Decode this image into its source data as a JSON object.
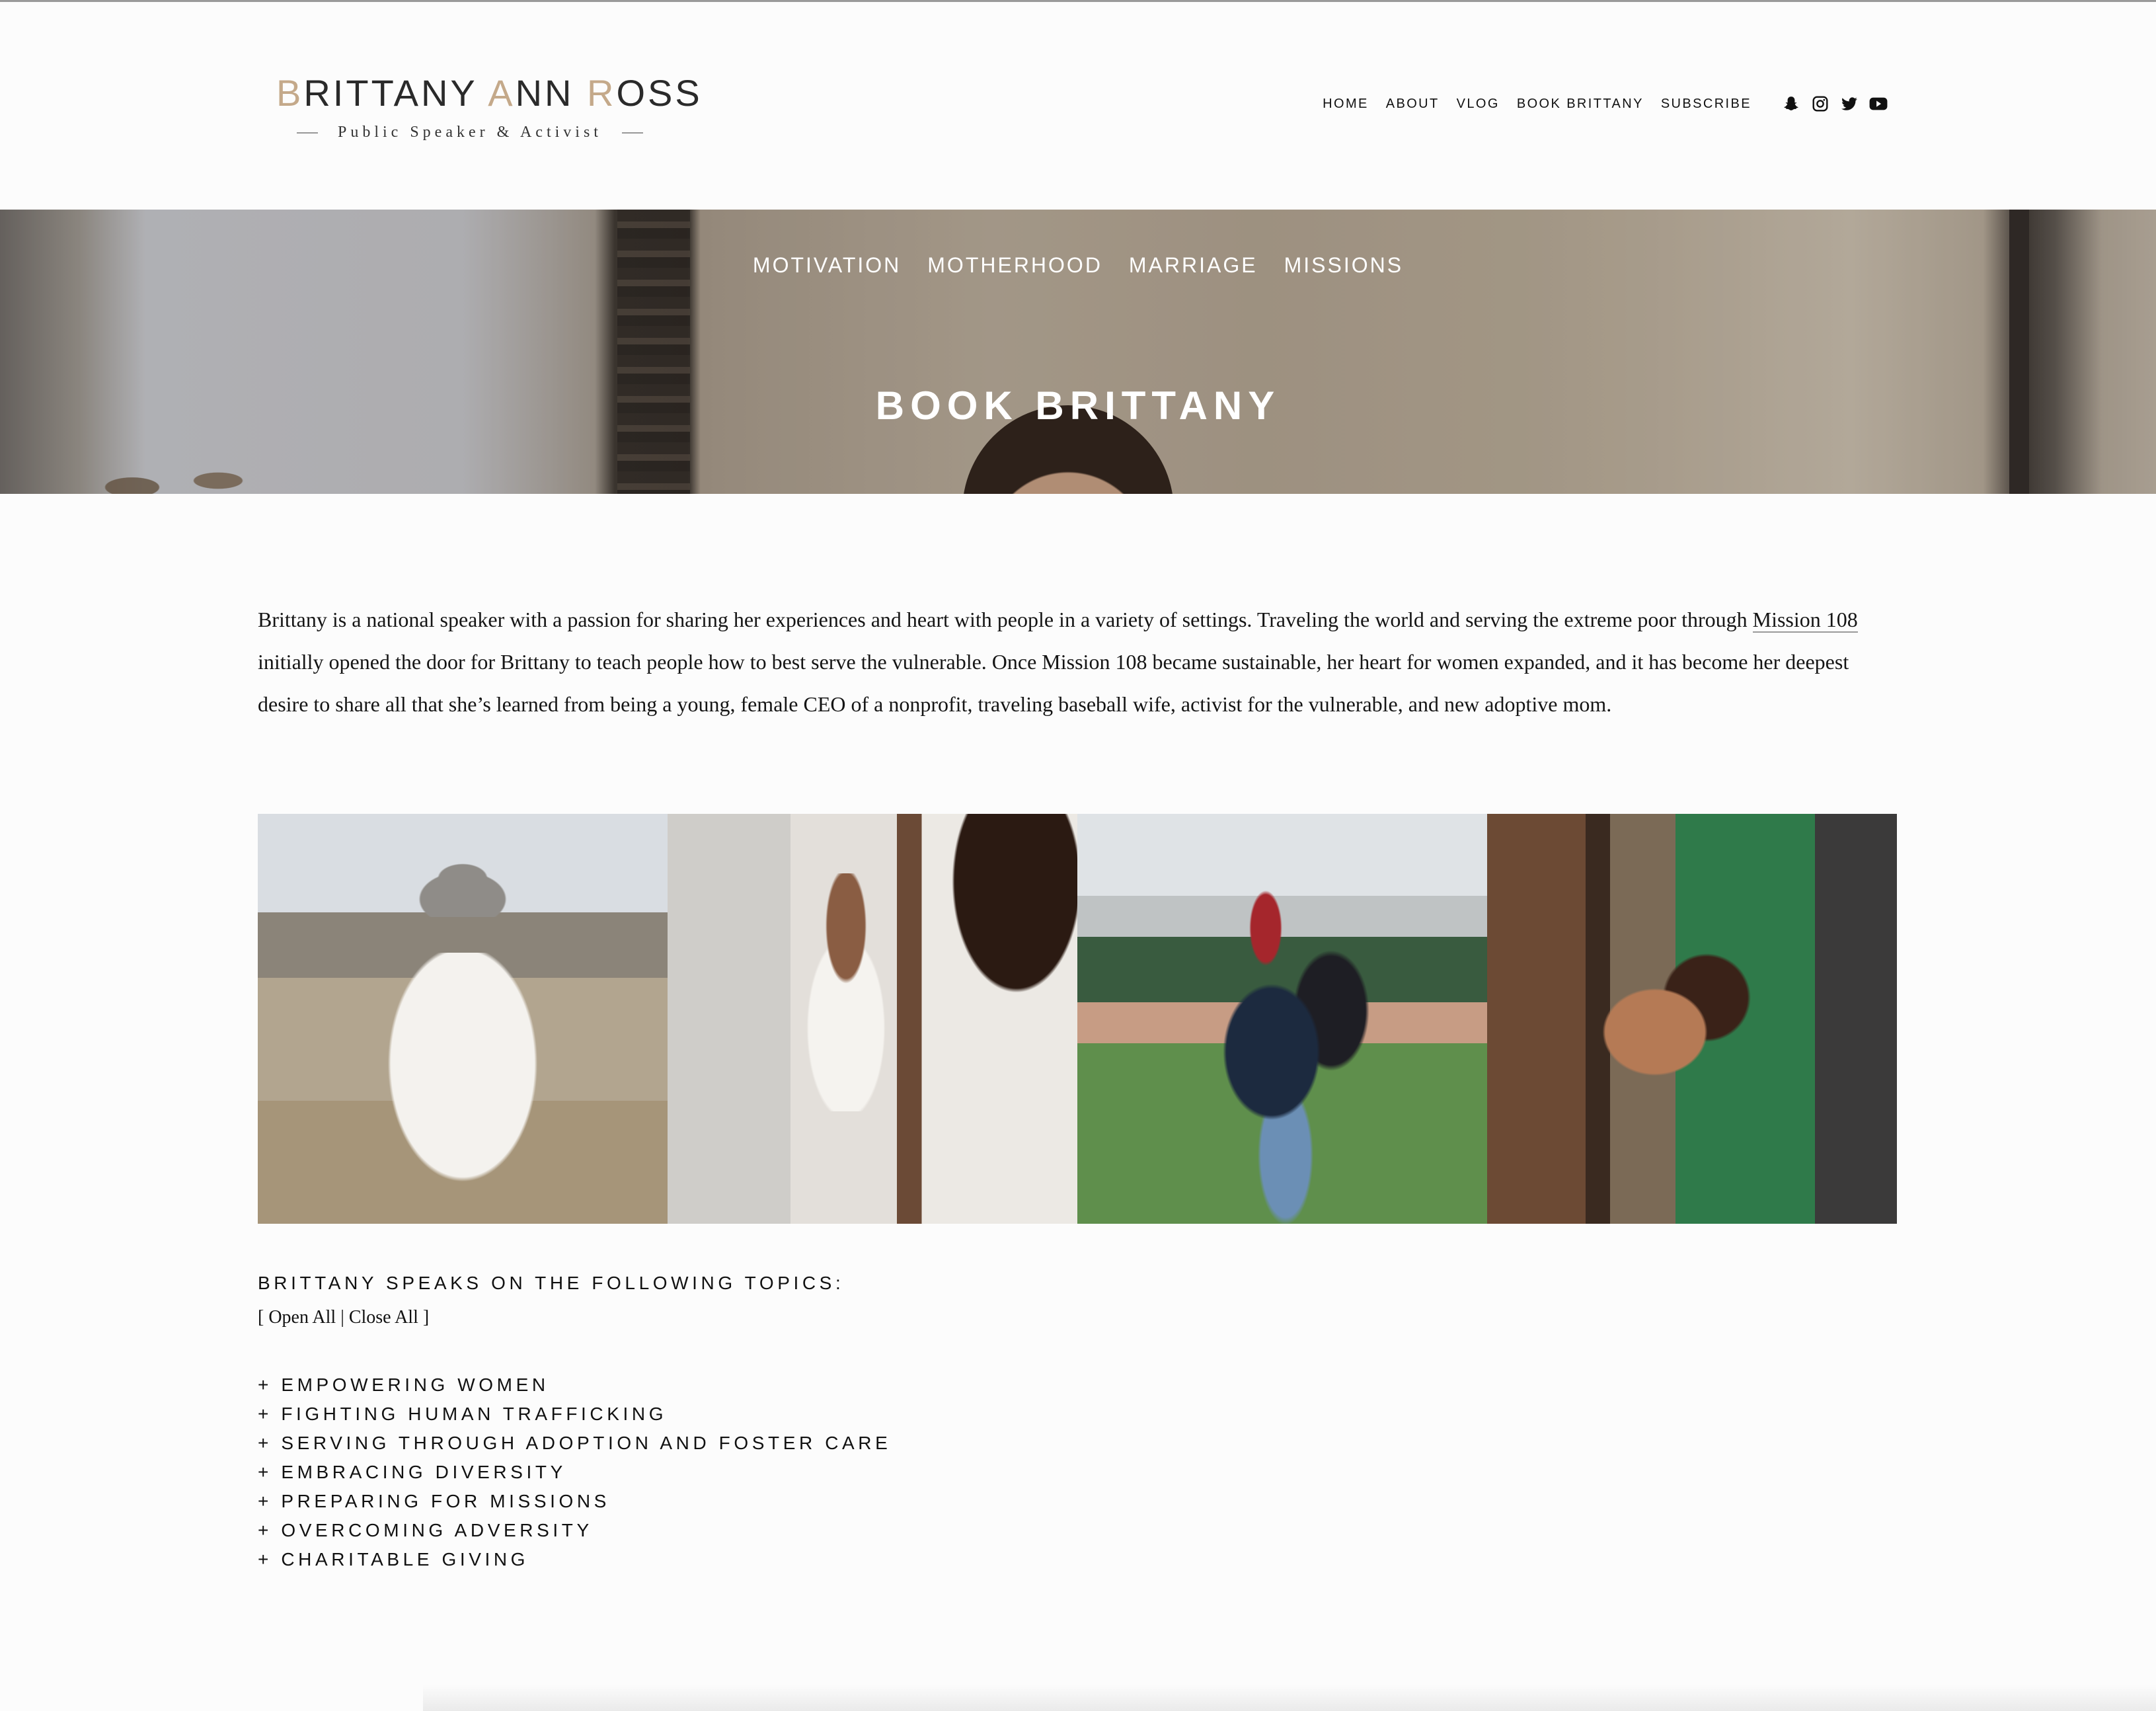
{
  "header": {
    "logo": {
      "name_part1": "B",
      "name_part2": "RITTANY ",
      "name_part3": "A",
      "name_part4": "NN ",
      "name_part5": "R",
      "name_part6": "OSS",
      "tagline": "Public Speaker & Activist"
    },
    "nav": [
      {
        "label": "HOME"
      },
      {
        "label": "ABOUT"
      },
      {
        "label": "VLOG"
      },
      {
        "label": "BOOK BRITTANY"
      },
      {
        "label": "SUBSCRIBE"
      }
    ],
    "social_icons": [
      "snapchat-icon",
      "instagram-icon",
      "twitter-icon",
      "youtube-icon"
    ]
  },
  "banner": {
    "topics": [
      {
        "label": "MOTIVATION"
      },
      {
        "label": "MOTHERHOOD"
      },
      {
        "label": "MARRIAGE"
      },
      {
        "label": "MISSIONS"
      }
    ],
    "title": "BOOK BRITTANY"
  },
  "intro": {
    "before_link": "Brittany is a national speaker with a passion for sharing her experiences and heart with people in a variety of settings. Traveling the world and serving the extreme poor through ",
    "link_text": "Mission 108",
    "after_link": " initially opened the door for Brittany to teach people how to best serve the vulnerable. Once Mission 108 became sustainable, her heart for women expanded, and it has become her deepest desire to share all that she’s learned from being a young, female CEO of a nonprofit, traveling baseball wife, activist for the vulnerable, and new adoptive mom."
  },
  "topics": {
    "heading": "BRITTANY SPEAKS ON THE FOLLOWING TOPICS:",
    "open_bracket": "[ ",
    "open_all": "Open All",
    "separator": " | ",
    "close_all": "Close All",
    "close_bracket": " ]",
    "items": [
      {
        "label": "+ EMPOWERING WOMEN"
      },
      {
        "label": "+ FIGHTING HUMAN TRAFFICKING"
      },
      {
        "label": "+ SERVING THROUGH ADOPTION AND FOSTER CARE"
      },
      {
        "label": "+ EMBRACING DIVERSITY"
      },
      {
        "label": "+ PREPARING FOR MISSIONS"
      },
      {
        "label": "+ OVERCOMING ADVERSITY"
      },
      {
        "label": "+ CHARITABLE GIVING"
      }
    ]
  },
  "colors": {
    "logo_accent": "#c4a98a",
    "text": "#111111",
    "background": "#fcfcfc"
  }
}
